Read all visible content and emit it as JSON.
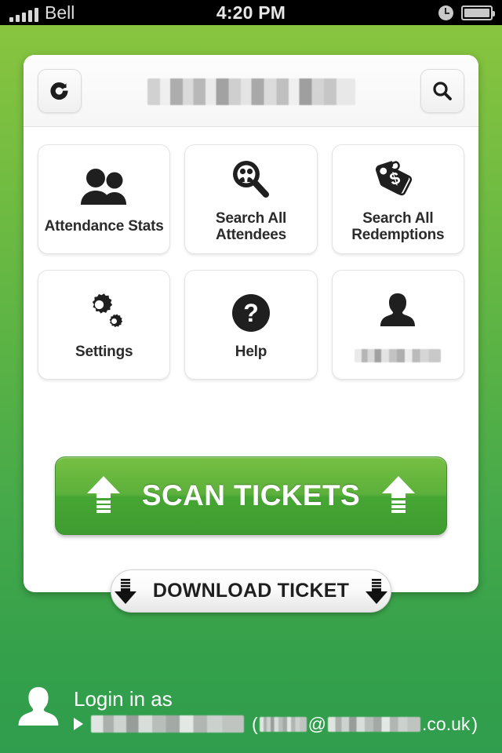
{
  "statusbar": {
    "carrier": "Bell",
    "time": "4:20 PM",
    "signal_bars": 5,
    "alarm_icon": "alarm-clock-icon",
    "battery_icon": "battery-full-icon"
  },
  "toolbar": {
    "refresh_icon": "refresh-icon",
    "search_icon": "search-icon",
    "title_redacted": true,
    "title": ""
  },
  "tiles": [
    {
      "id": "attendance-stats",
      "icon": "two-people-icon",
      "label": "Attendance Stats",
      "redacted": false
    },
    {
      "id": "search-all-attendees",
      "icon": "magnifier-people-icon",
      "label": "Search All Attendees",
      "redacted": false
    },
    {
      "id": "search-all-redemptions",
      "icon": "price-tag-dollar-icon",
      "label": "Search All Redemptions",
      "redacted": false
    },
    {
      "id": "settings",
      "icon": "gears-icon",
      "label": "Settings",
      "redacted": false
    },
    {
      "id": "help",
      "icon": "question-mark-circle-icon",
      "label": "Help",
      "redacted": false
    },
    {
      "id": "user-account",
      "icon": "person-icon",
      "label": "",
      "redacted": true
    }
  ],
  "scan_button": {
    "label": "SCAN TICKETS",
    "left_icon": "upload-arrow-icon",
    "right_icon": "upload-arrow-icon",
    "color": "#5cb03b"
  },
  "download_button": {
    "label": "DOWNLOAD TICKET",
    "left_icon": "download-arrow-icon",
    "right_icon": "download-arrow-icon"
  },
  "footer": {
    "avatar_icon": "person-avatar-icon",
    "title": "Login in as",
    "bullet_icon": "play-triangle-icon",
    "name": "",
    "name_redacted": true,
    "email_open_paren": "(",
    "email_at": "@",
    "email_domain_suffix": ".co.uk",
    "email_close_paren": ")",
    "email_redacted": true
  },
  "colors": {
    "background_top": "#8cc63e",
    "background_bottom": "#2f9d4d",
    "card": "#ffffff",
    "text_dark": "#2b2b2b",
    "scan_green": "#5cb03b"
  }
}
